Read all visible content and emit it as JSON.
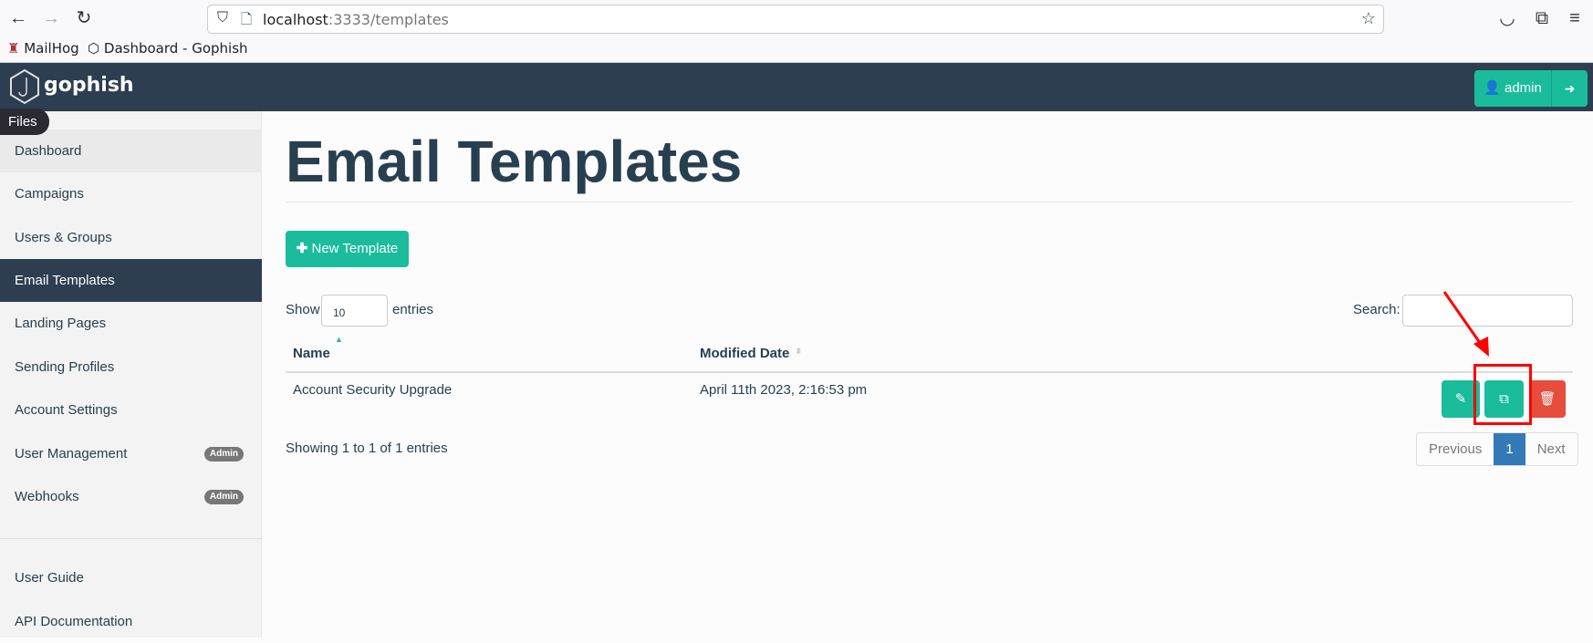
{
  "browser": {
    "url_host": "localhost",
    "url_rest": ":3333/templates",
    "bookmarks": [
      "MailHog",
      "Dashboard - Gophish"
    ]
  },
  "navbar": {
    "brand": "gophish",
    "user": "admin"
  },
  "tooltip": "Files",
  "sidebar": {
    "items": [
      {
        "label": "Dashboard"
      },
      {
        "label": "Campaigns"
      },
      {
        "label": "Users & Groups"
      },
      {
        "label": "Email Templates",
        "active": true
      },
      {
        "label": "Landing Pages"
      },
      {
        "label": "Sending Profiles"
      },
      {
        "label": "Account Settings"
      },
      {
        "label": "User Management",
        "badge": "Admin"
      },
      {
        "label": "Webhooks",
        "badge": "Admin"
      }
    ],
    "footer": [
      {
        "label": "User Guide"
      },
      {
        "label": "API Documentation"
      }
    ]
  },
  "main": {
    "title": "Email Templates",
    "new_button": "New Template",
    "show_label": "Show",
    "entries_value": "10",
    "entries_label": "entries",
    "search_label": "Search:",
    "search_value": "",
    "columns": [
      "Name",
      "Modified Date"
    ],
    "rows": [
      {
        "name": "Account Security Upgrade",
        "modified": "April 11th 2023, 2:16:53 pm"
      }
    ],
    "info": "Showing 1 to 1 of 1 entries",
    "pagination": {
      "previous": "Previous",
      "current": "1",
      "next": "Next"
    }
  },
  "colors": {
    "navbar": "#2c3e50",
    "primary": "#1abc9c",
    "danger": "#e74c3c",
    "annotation": "#ff0000"
  }
}
